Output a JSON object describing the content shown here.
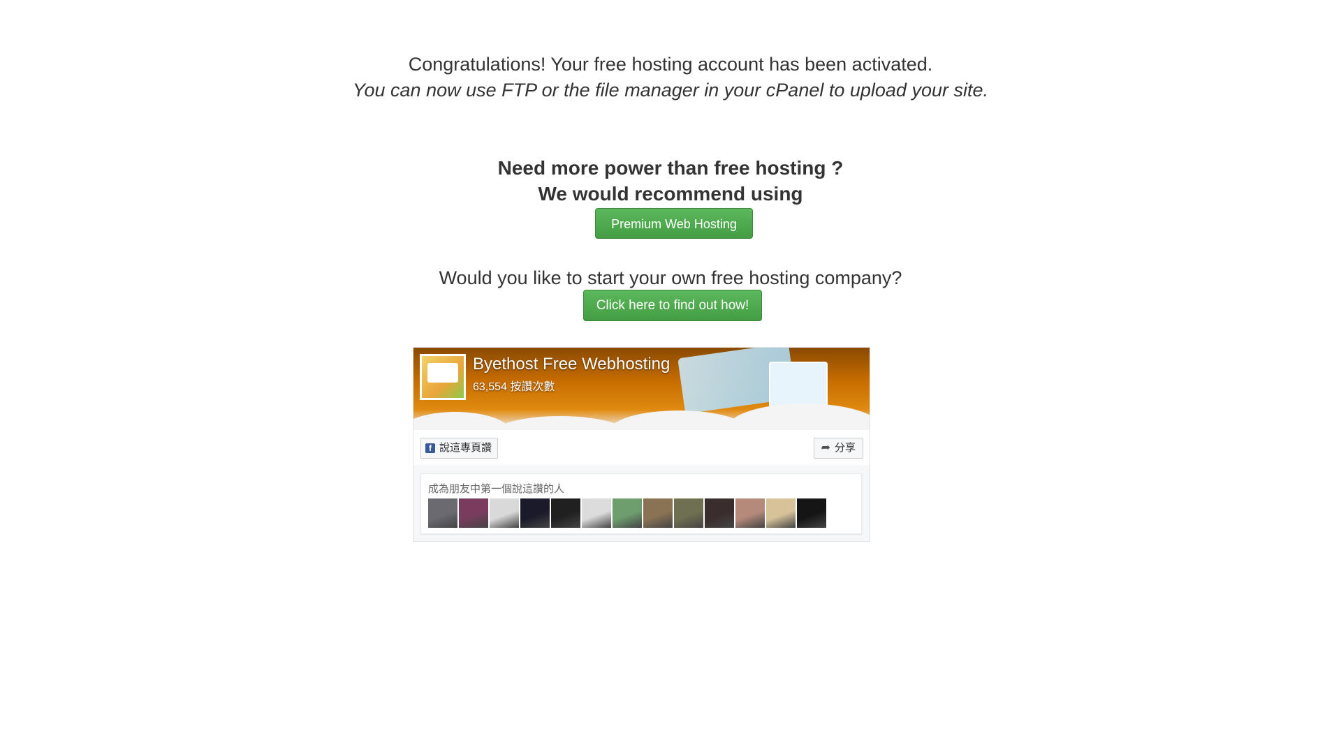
{
  "message": {
    "line1": "Congratulations! Your free hosting account has been activated.",
    "line2": "You can now use FTP or the file manager in your cPanel to upload your site."
  },
  "upsell": {
    "line1": "Need more power than free hosting ?",
    "line2": "We would recommend using",
    "button_label": "Premium Web Hosting"
  },
  "reseller": {
    "question": "Would you like to start your own free hosting company?",
    "button_label": "Click here to find out how!"
  },
  "facebook_widget": {
    "page_name": "Byethost Free Webhosting",
    "likes_text": "63,554 按讚次數",
    "like_button_label": "說這專頁讚",
    "share_button_label": "分享",
    "friends_prompt": "成為朋友中第一個說這讚的人",
    "friend_avatar_colors": [
      "#6b6a70",
      "#7a3c5e",
      "#d9d9d9",
      "#1a1a2a",
      "#202020",
      "#dcdcdc",
      "#6e9e6e",
      "#8a7355",
      "#6f6f52",
      "#3a2d2d",
      "#b58a7a",
      "#d7c29a",
      "#151515"
    ]
  }
}
